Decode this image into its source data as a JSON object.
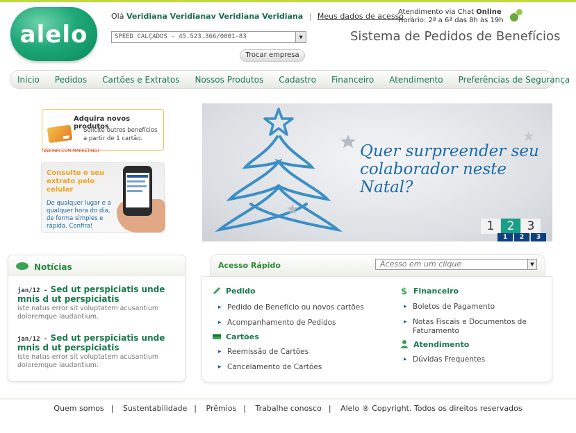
{
  "brand": {
    "logo_text": "alelo",
    "accent": "#1ea878"
  },
  "header": {
    "greeting_prefix": "Olá",
    "user_name": "Veridiana Veridianav Veridiana Veridiana",
    "my_data_link": "Meus dados de acesso",
    "chat_line1_prefix": "Atendimento via Chat",
    "chat_status": "Online",
    "chat_line2": "Horário: 2ª a 6ª das 8h às 19h",
    "company_value": "SPEED CALÇADOS - 45.523.366/0001-83",
    "change_company_button": "Trocar empresa",
    "system_title": "Sistema de Pedidos de Benefícios"
  },
  "nav": {
    "items": [
      "Início",
      "Pedidos",
      "Cartões e Extratos",
      "Nossos Produtos",
      "Cadastro",
      "Financeiro",
      "Atendimento",
      "Preferências de Segurança"
    ]
  },
  "promo1": {
    "title": "Adquira novos produtos",
    "desc": "Solicite outros benefícios a partir de 1 cartão.",
    "note": "(DEFINIR COM MARKETING)"
  },
  "promo2": {
    "headline": "Consulte o seu extrato pelo celular",
    "text": "De qualquer lugar e a qualquer hora do dia, de forma simples e rápida. Confira!"
  },
  "banner": {
    "headline": "Quer surpreender seu colaborador neste Natal?",
    "pages": [
      "1",
      "2",
      "3"
    ],
    "active_page": "2",
    "mini_pages": [
      "1",
      "2",
      "3"
    ]
  },
  "news": {
    "title": "Notícias",
    "items": [
      {
        "date": "jan/12 -",
        "headline": "Sed ut perspiciatis unde mnis d ut perspiciatis",
        "body": "iste natus error sit voluptatem acusantium doloremque laudantium."
      },
      {
        "date": "jan/12 -",
        "headline": "Sed ut perspiciatis unde mnis d ut perspiciatis",
        "body": "iste natus error sit voluptatem acusantium doloremque laudantium."
      }
    ]
  },
  "quick_access": {
    "title": "Acesso Rápido",
    "select_placeholder": "Acesso em um clique",
    "sections": {
      "pedido": {
        "title": "Pedido",
        "links": [
          "Pedido de Benefício ou novos cartões",
          "Acompanhamento de Pedidos"
        ]
      },
      "cartoes": {
        "title": "Cartões",
        "links": [
          "Reemissão de Cartões",
          "Cancelamento de Cartões"
        ]
      },
      "financeiro": {
        "title": "Financeiro",
        "links": [
          "Boletos de Pagamento",
          "Notas Fiscais e Documentos de Faturamento"
        ]
      },
      "atendimento": {
        "title": "Atendimento",
        "links": [
          "Dúvidas Frequentes"
        ]
      }
    }
  },
  "footer": {
    "links": [
      "Quem somos",
      "Sustentabilidade",
      "Prêmios",
      "Trabalhe conosco"
    ],
    "copyright": "Alelo ® Copyright. Todos os direitos reservados"
  }
}
